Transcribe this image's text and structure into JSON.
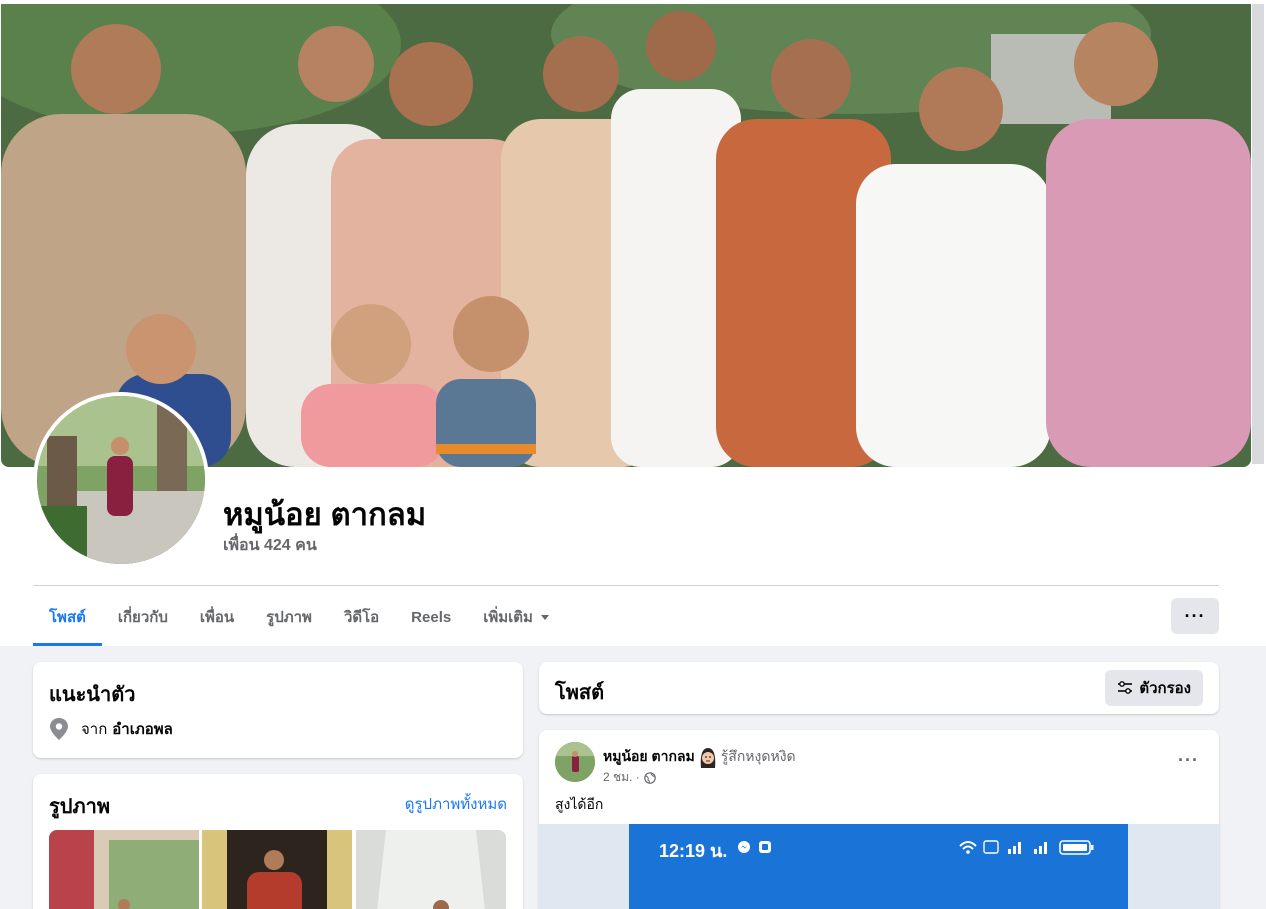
{
  "profile": {
    "name": "หมูน้อย ตากลม",
    "friends": "เพื่อน 424 คน"
  },
  "tabs": [
    {
      "label": "โพสต์",
      "active": true
    },
    {
      "label": "เกี่ยวกับ",
      "active": false
    },
    {
      "label": "เพื่อน",
      "active": false
    },
    {
      "label": "รูปภาพ",
      "active": false
    },
    {
      "label": "วิดีโอ",
      "active": false
    },
    {
      "label": "Reels",
      "active": false
    },
    {
      "label": "เพิ่มเติม",
      "active": false
    }
  ],
  "more_button": "···",
  "intro": {
    "title": "แนะนำตัว",
    "from_label": "จาก",
    "from_place": "อำเภอพล"
  },
  "photos": {
    "title": "รูปภาพ",
    "see_all": "ดูรูปภาพทั้งหมด"
  },
  "posts_header": {
    "title": "โพสต์",
    "filter": "ตัวกรอง"
  },
  "post": {
    "author": "หมูน้อย ตากลม",
    "feeling": "รู้สึกหงุดหงิด",
    "time": "2 ชม. ·",
    "text": "สูงได้อีก",
    "more": "···",
    "media_time": "12:19 น."
  },
  "colors": {
    "accent": "#1877f2",
    "background": "#f0f2f5",
    "secondary_text": "#65676b"
  }
}
